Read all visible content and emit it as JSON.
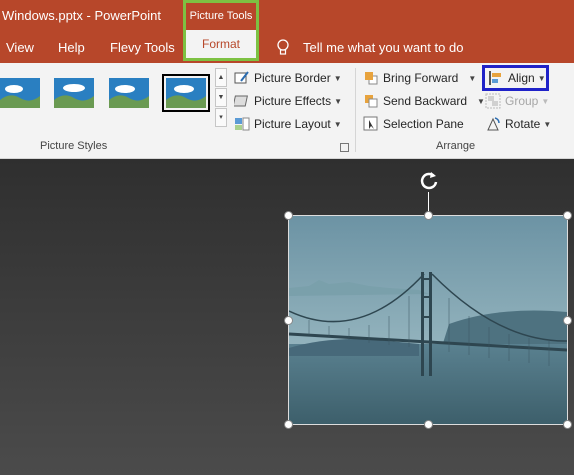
{
  "titlebar": {
    "title": "Windows.pptx  -  PowerPoint"
  },
  "tabs": [
    {
      "label": "View"
    },
    {
      "label": "Help"
    },
    {
      "label": "Flevy Tools"
    }
  ],
  "contextual_tab": {
    "group": "Picture Tools",
    "label": "Format"
  },
  "tell_me": {
    "label": "Tell me what you want to do"
  },
  "ribbon": {
    "picture_styles": {
      "buttons": [
        {
          "label": "Picture Border",
          "icon": "picture-border-icon"
        },
        {
          "label": "Picture Effects",
          "icon": "picture-effects-icon"
        },
        {
          "label": "Picture Layout",
          "icon": "picture-layout-icon"
        }
      ],
      "group_label": "Picture Styles"
    },
    "arrange": {
      "buttons": [
        {
          "label": "Bring Forward",
          "icon": "bring-forward-icon"
        },
        {
          "label": "Send Backward",
          "icon": "send-backward-icon"
        },
        {
          "label": "Selection Pane",
          "icon": "selection-pane-icon"
        },
        {
          "label": "Align",
          "icon": "align-icon"
        },
        {
          "label": "Group",
          "icon": "group-icon",
          "disabled": true
        },
        {
          "label": "Rotate",
          "icon": "rotate-icon"
        }
      ],
      "group_label": "Arrange"
    }
  },
  "colors": {
    "accent": "#b7472a",
    "highlight_green": "#7dc142",
    "highlight_blue": "#1f22c8"
  }
}
